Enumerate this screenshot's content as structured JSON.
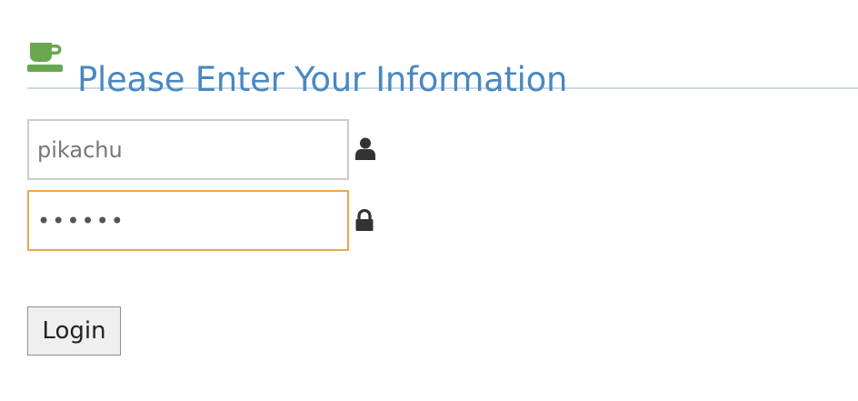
{
  "header": {
    "title": "Please Enter Your Information",
    "icon": "coffee-cup-icon"
  },
  "form": {
    "username": {
      "value": "pikachu",
      "icon": "user-icon"
    },
    "password": {
      "value": "••••••",
      "icon": "lock-icon",
      "focused": true
    },
    "submit_label": "Login"
  },
  "colors": {
    "title": "#4a88c0",
    "title_icon": "#6aa84f",
    "header_rule": "#c9dbe9",
    "focus_border": "#f0a54a",
    "field_border": "#cccccc",
    "icon_dark": "#333333"
  }
}
